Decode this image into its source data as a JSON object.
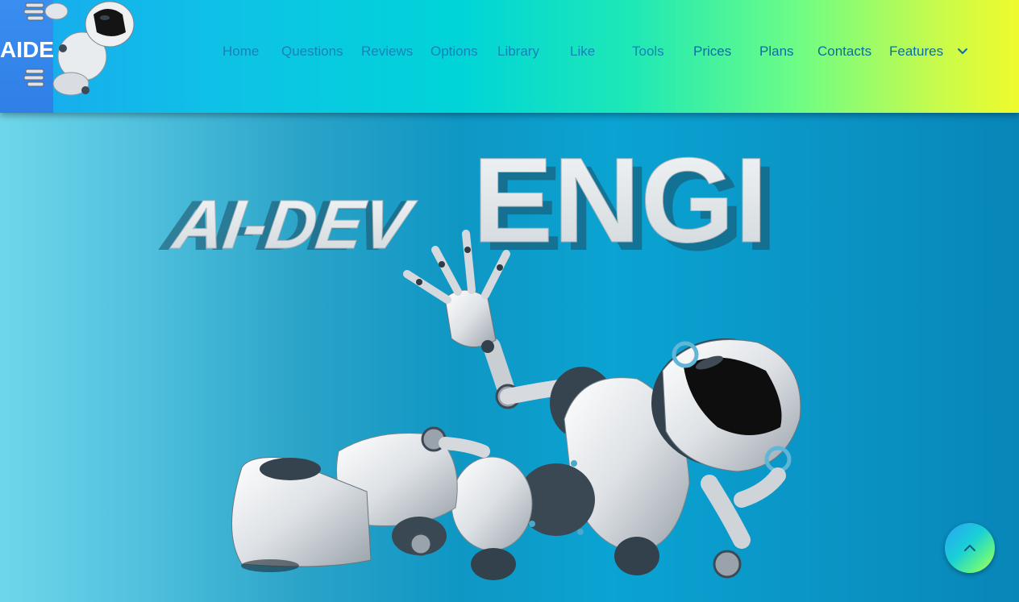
{
  "brand": {
    "logo_text": "AIDE"
  },
  "nav": {
    "items": [
      {
        "label": "Home"
      },
      {
        "label": "Questions"
      },
      {
        "label": "Reviews"
      },
      {
        "label": "Options"
      },
      {
        "label": "Library"
      },
      {
        "label": "Like"
      },
      {
        "label": "Tools"
      },
      {
        "label": "Prices"
      },
      {
        "label": "Plans"
      },
      {
        "label": "Contacts"
      },
      {
        "label": "Features"
      }
    ],
    "features_icon": "chevron-down-icon"
  },
  "hero": {
    "headline_word_1": "AI-DEV",
    "headline_word_2": "ENGI"
  },
  "scroll_top": {
    "icon": "chevron-up-icon"
  },
  "colors": {
    "header_gradient": [
      "#1aa8f0",
      "#00d4d8",
      "#6cfc86",
      "#eefb2c"
    ],
    "nav_text": "#1683b8",
    "hero_background": "#0a95c6"
  }
}
